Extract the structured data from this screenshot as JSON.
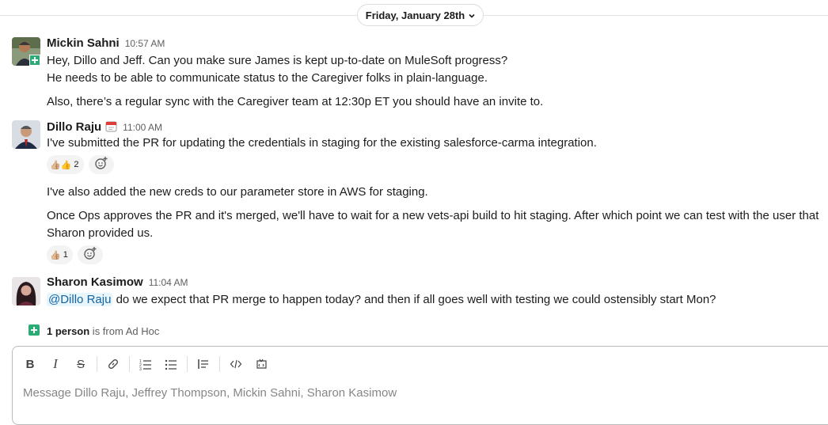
{
  "date_divider": {
    "label": "Friday, January 28th"
  },
  "messages": [
    {
      "author": "Mickin Sahni",
      "time": "10:57 AM",
      "lines": [
        "Hey, Dillo and Jeff. Can you make sure James is kept up-to-date on MuleSoft progress?",
        "He needs to be able to communicate status to the Caregiver folks in plain-language.",
        "Also, there’s a regular sync with the Caregiver team at 12:30p ET you should have an invite to."
      ]
    },
    {
      "author": "Dillo Raju",
      "status_icon": "calendar-icon",
      "time": "11:00 AM",
      "lines": [
        "I've submitted the PR for updating the credentials in staging for the existing salesforce-carma integration.",
        "I've also added the new creds to our parameter store in AWS for staging.",
        "Once Ops approves the PR and it's merged, we'll have to wait for a new vets-api build to hit staging. After which point we can test with the user that",
        "Sharon provided us."
      ],
      "reactions": [
        {
          "emoji": "👍🏼👍",
          "count": "2"
        },
        {
          "emoji": "👍🏼",
          "count": "1"
        }
      ]
    },
    {
      "author": "Sharon Kasimow",
      "time": "11:04 AM",
      "mention": "@Dillo Raju",
      "text": " do we expect that PR merge to happen today? and then if all goes well with testing we could ostensibly start Mon?"
    }
  ],
  "external_note": {
    "count": "1 person",
    "text": " is from Ad Hoc"
  },
  "composer": {
    "placeholder": "Message Dillo Raju, Jeffrey Thompson, Mickin Sahni, Sharon Kasimow",
    "toolbar": [
      "bold-icon",
      "italic-icon",
      "strikethrough-icon",
      "link-icon",
      "ordered-list-icon",
      "bulleted-list-icon",
      "blockquote-icon",
      "code-icon",
      "code-block-icon"
    ]
  },
  "colors": {
    "link": "#1264a3",
    "mention_bg": "#e8f5fa",
    "external_badge": "#2bac76"
  }
}
